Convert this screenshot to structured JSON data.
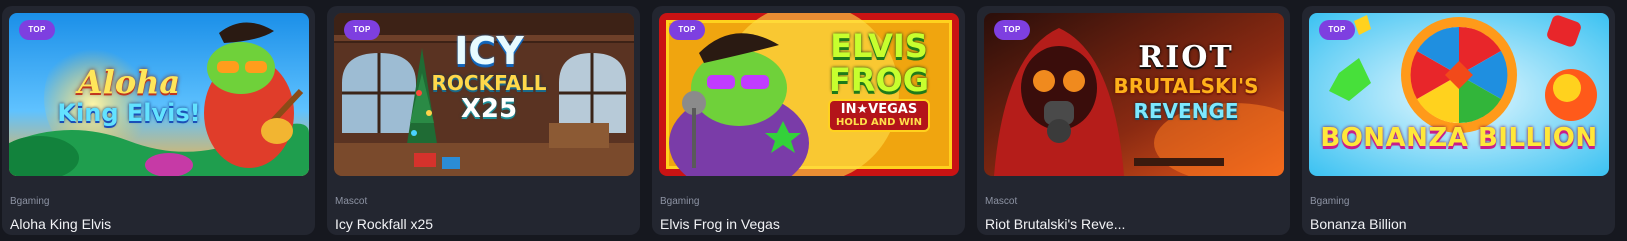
{
  "games": [
    {
      "badge": "TOP",
      "provider": "Bgaming",
      "title": "Aloha King Elvis",
      "art_line1": "Aloha",
      "art_line2": "King Elvis!"
    },
    {
      "badge": "TOP",
      "provider": "Mascot",
      "title": "Icy Rockfall x25",
      "art_line1": "ICY",
      "art_line2": "ROCKFALL",
      "art_line3": "X25"
    },
    {
      "badge": "TOP",
      "provider": "Bgaming",
      "title": "Elvis Frog in Vegas",
      "art_line1": "ELVIS",
      "art_line2": "FROG",
      "art_line3": "IN★VEGAS",
      "art_line4": "HOLD AND WIN"
    },
    {
      "badge": "TOP",
      "provider": "Mascot",
      "title": "Riot Brutalski's Reve...",
      "art_line1": "RIOT",
      "art_line2": "BRUTALSKI'S",
      "art_line3": "REVENGE"
    },
    {
      "badge": "TOP",
      "provider": "Bgaming",
      "title": "Bonanza Billion",
      "art_line1": "BONANZA BILLION"
    }
  ],
  "colors": {
    "page_bg": "#16181f",
    "card_bg": "#232630",
    "badge_bg": "#7e3fe0",
    "provider_text": "#8d93a3",
    "title_text": "#f2f3f6"
  }
}
